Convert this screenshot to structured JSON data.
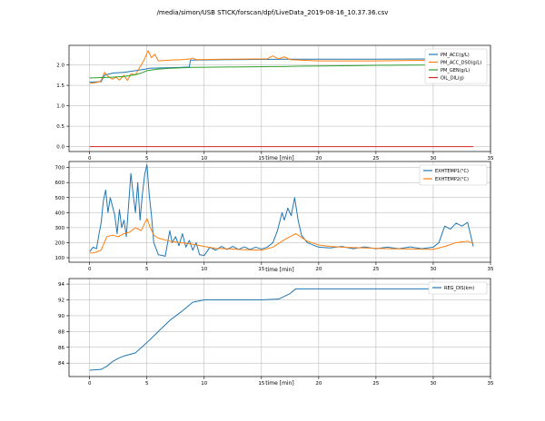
{
  "figure": {
    "title": "/media/simon/USB STICK/forscan/dpf/LiveData_2019-08-16_10.37.36.csv"
  },
  "colors": {
    "blue": "#1f77b4",
    "orange": "#ff7f0e",
    "green": "#2ca02c",
    "red": "#d62728",
    "grid": "#b0b0b0"
  },
  "chart_data": [
    {
      "type": "line",
      "xlabel": "time [min]",
      "ylabel": "",
      "xlim": [
        -1.8,
        35
      ],
      "ylim": [
        -0.12,
        2.48
      ],
      "xticks": [
        0,
        5,
        10,
        15,
        20,
        25,
        30,
        35
      ],
      "yticks": [
        0.0,
        0.5,
        1.0,
        1.5,
        2.0
      ],
      "ytick_labels": [
        "0.0",
        "0.5",
        "1.0",
        "1.5",
        "2.0"
      ],
      "grid": true,
      "legend_position": "top-right",
      "series": [
        {
          "name": "PM_ACC(g/L)",
          "color": "#1f77b4",
          "points": [
            [
              0,
              1.58
            ],
            [
              1,
              1.59
            ],
            [
              1.3,
              1.75
            ],
            [
              2,
              1.8
            ],
            [
              3,
              1.82
            ],
            [
              4,
              1.86
            ],
            [
              4.9,
              1.9
            ],
            [
              5.2,
              1.92
            ],
            [
              8,
              1.94
            ],
            [
              8.7,
              1.95
            ],
            [
              8.8,
              2.12
            ],
            [
              12,
              2.13
            ],
            [
              17,
              2.14
            ],
            [
              25,
              2.14
            ],
            [
              31.5,
              2.15
            ],
            [
              33.5,
              2.15
            ]
          ]
        },
        {
          "name": "PM_ACC_DSO(g/L)",
          "color": "#ff7f0e",
          "points": [
            [
              0,
              1.55
            ],
            [
              0.8,
              1.58
            ],
            [
              1,
              1.62
            ],
            [
              1.3,
              1.82
            ],
            [
              1.6,
              1.72
            ],
            [
              2,
              1.65
            ],
            [
              2.3,
              1.7
            ],
            [
              2.6,
              1.63
            ],
            [
              3,
              1.75
            ],
            [
              3.3,
              1.62
            ],
            [
              3.6,
              1.78
            ],
            [
              4,
              1.76
            ],
            [
              4.5,
              2.0
            ],
            [
              4.8,
              2.15
            ],
            [
              5.1,
              2.35
            ],
            [
              5.4,
              2.18
            ],
            [
              5.7,
              2.26
            ],
            [
              6,
              2.1
            ],
            [
              6.5,
              2.11
            ],
            [
              7,
              2.12
            ],
            [
              8,
              2.13
            ],
            [
              8.8,
              2.15
            ],
            [
              9,
              2.17
            ],
            [
              9.3,
              2.13
            ],
            [
              12,
              2.14
            ],
            [
              15.5,
              2.15
            ],
            [
              16,
              2.22
            ],
            [
              16.5,
              2.15
            ],
            [
              17,
              2.2
            ],
            [
              17.5,
              2.13
            ],
            [
              20,
              2.1
            ],
            [
              25,
              2.1
            ],
            [
              28,
              2.11
            ],
            [
              30.5,
              2.12
            ],
            [
              31,
              2.14
            ],
            [
              33.5,
              2.14
            ]
          ]
        },
        {
          "name": "PM_GEN(g/L)",
          "color": "#2ca02c",
          "points": [
            [
              0,
              1.68
            ],
            [
              1,
              1.69
            ],
            [
              2,
              1.7
            ],
            [
              3,
              1.72
            ],
            [
              4,
              1.76
            ],
            [
              4.5,
              1.8
            ],
            [
              5,
              1.86
            ],
            [
              6,
              1.9
            ],
            [
              7,
              1.92
            ],
            [
              9,
              1.94
            ],
            [
              12,
              1.95
            ],
            [
              16,
              1.96
            ],
            [
              17,
              1.96
            ],
            [
              18,
              1.97
            ],
            [
              22,
              1.98
            ],
            [
              25,
              1.99
            ],
            [
              30,
              2.0
            ],
            [
              31,
              2.02
            ],
            [
              33.5,
              2.03
            ]
          ]
        },
        {
          "name": "OIL_DIL(g)",
          "color": "#d62728",
          "points": [
            [
              0,
              0.0
            ],
            [
              33.5,
              0.0
            ]
          ]
        }
      ]
    },
    {
      "type": "line",
      "xlabel": "time [min]",
      "ylabel": "",
      "xlim": [
        -1.8,
        35
      ],
      "ylim": [
        70,
        740
      ],
      "xticks": [
        0,
        5,
        10,
        15,
        20,
        25,
        30,
        35
      ],
      "yticks": [
        100,
        200,
        300,
        400,
        500,
        600,
        700
      ],
      "ytick_labels": [
        "100",
        "200",
        "300",
        "400",
        "500",
        "600",
        "700"
      ],
      "grid": true,
      "legend_position": "top-right",
      "series": [
        {
          "name": "EXHTEMP1(°C)",
          "color": "#1f77b4",
          "points": [
            [
              0,
              140
            ],
            [
              0.3,
              170
            ],
            [
              0.6,
              160
            ],
            [
              0.8,
              250
            ],
            [
              1,
              330
            ],
            [
              1.2,
              480
            ],
            [
              1.4,
              550
            ],
            [
              1.6,
              400
            ],
            [
              1.8,
              500
            ],
            [
              2,
              440
            ],
            [
              2.2,
              380
            ],
            [
              2.4,
              260
            ],
            [
              2.6,
              420
            ],
            [
              2.8,
              300
            ],
            [
              3,
              350
            ],
            [
              3.2,
              240
            ],
            [
              3.4,
              450
            ],
            [
              3.6,
              660
            ],
            [
              3.8,
              520
            ],
            [
              4,
              400
            ],
            [
              4.2,
              600
            ],
            [
              4.4,
              350
            ],
            [
              4.6,
              520
            ],
            [
              4.8,
              650
            ],
            [
              5,
              720
            ],
            [
              5.2,
              520
            ],
            [
              5.4,
              380
            ],
            [
              5.6,
              200
            ],
            [
              5.8,
              160
            ],
            [
              6,
              120
            ],
            [
              6.3,
              115
            ],
            [
              6.6,
              110
            ],
            [
              7,
              280
            ],
            [
              7.2,
              200
            ],
            [
              7.5,
              240
            ],
            [
              7.8,
              180
            ],
            [
              8.1,
              260
            ],
            [
              8.4,
              170
            ],
            [
              8.7,
              215
            ],
            [
              9,
              150
            ],
            [
              9.3,
              200
            ],
            [
              9.6,
              120
            ],
            [
              10,
              115
            ],
            [
              10.5,
              170
            ],
            [
              11,
              150
            ],
            [
              11.5,
              175
            ],
            [
              12,
              155
            ],
            [
              12.5,
              175
            ],
            [
              13,
              155
            ],
            [
              13.5,
              172
            ],
            [
              14,
              155
            ],
            [
              14.5,
              170
            ],
            [
              15,
              158
            ],
            [
              15.5,
              170
            ],
            [
              16,
              200
            ],
            [
              16.4,
              280
            ],
            [
              16.8,
              400
            ],
            [
              17,
              350
            ],
            [
              17.3,
              430
            ],
            [
              17.6,
              380
            ],
            [
              17.9,
              500
            ],
            [
              18.2,
              350
            ],
            [
              18.5,
              250
            ],
            [
              19,
              200
            ],
            [
              19.5,
              185
            ],
            [
              20,
              170
            ],
            [
              21,
              165
            ],
            [
              22,
              175
            ],
            [
              23,
              160
            ],
            [
              24,
              172
            ],
            [
              25,
              160
            ],
            [
              26,
              170
            ],
            [
              27,
              160
            ],
            [
              28,
              172
            ],
            [
              29,
              160
            ],
            [
              30,
              170
            ],
            [
              30.5,
              200
            ],
            [
              31,
              310
            ],
            [
              31.5,
              290
            ],
            [
              32,
              330
            ],
            [
              32.5,
              310
            ],
            [
              33,
              335
            ],
            [
              33.5,
              175
            ]
          ]
        },
        {
          "name": "EXHTEMP2(°C)",
          "color": "#ff7f0e",
          "points": [
            [
              0,
              130
            ],
            [
              0.5,
              135
            ],
            [
              1,
              150
            ],
            [
              1.5,
              240
            ],
            [
              2,
              250
            ],
            [
              2.5,
              240
            ],
            [
              3,
              260
            ],
            [
              3.5,
              270
            ],
            [
              4,
              300
            ],
            [
              4.5,
              280
            ],
            [
              5,
              360
            ],
            [
              5.3,
              300
            ],
            [
              5.6,
              250
            ],
            [
              6,
              230
            ],
            [
              7,
              210
            ],
            [
              8,
              200
            ],
            [
              9,
              190
            ],
            [
              10,
              175
            ],
            [
              11,
              162
            ],
            [
              12,
              160
            ],
            [
              13,
              155
            ],
            [
              14,
              152
            ],
            [
              15,
              150
            ],
            [
              16,
              170
            ],
            [
              17,
              220
            ],
            [
              17.5,
              240
            ],
            [
              18,
              260
            ],
            [
              19,
              210
            ],
            [
              20,
              185
            ],
            [
              21,
              175
            ],
            [
              22,
              170
            ],
            [
              24,
              165
            ],
            [
              26,
              160
            ],
            [
              28,
              158
            ],
            [
              30,
              155
            ],
            [
              31,
              175
            ],
            [
              32,
              200
            ],
            [
              33,
              210
            ],
            [
              33.5,
              195
            ]
          ]
        }
      ]
    },
    {
      "type": "line",
      "xlabel": "time [min]",
      "ylabel": "",
      "xlim": [
        -1.8,
        35
      ],
      "ylim": [
        82.3,
        94.7
      ],
      "xticks": [
        0,
        5,
        10,
        15,
        20,
        25,
        30,
        35
      ],
      "yticks": [
        84,
        86,
        88,
        90,
        92,
        94
      ],
      "ytick_labels": [
        "84",
        "86",
        "88",
        "90",
        "92",
        "94"
      ],
      "grid": true,
      "legend_position": "top-right",
      "series": [
        {
          "name": "REG_DIS(km)",
          "color": "#1f77b4",
          "points": [
            [
              0,
              83.1
            ],
            [
              1,
              83.2
            ],
            [
              1.5,
              83.6
            ],
            [
              2,
              84.2
            ],
            [
              2.5,
              84.6
            ],
            [
              3,
              84.9
            ],
            [
              4,
              85.3
            ],
            [
              5,
              86.6
            ],
            [
              6,
              88.0
            ],
            [
              7,
              89.4
            ],
            [
              8,
              90.5
            ],
            [
              9,
              91.7
            ],
            [
              10,
              92.0
            ],
            [
              12,
              92.0
            ],
            [
              15,
              92.0
            ],
            [
              16.5,
              92.1
            ],
            [
              17.5,
              92.8
            ],
            [
              18,
              93.4
            ],
            [
              20,
              93.4
            ],
            [
              25,
              93.4
            ],
            [
              30,
              93.4
            ],
            [
              31,
              93.5
            ],
            [
              33.5,
              93.5
            ]
          ]
        }
      ]
    }
  ]
}
